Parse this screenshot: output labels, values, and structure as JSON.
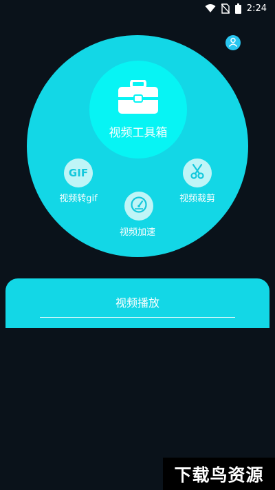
{
  "status_bar": {
    "time": "2:24",
    "icons": [
      "wifi-icon",
      "no-sim-icon",
      "battery-icon"
    ]
  },
  "header": {
    "avatar_icon": "user-icon"
  },
  "toolbox": {
    "label": "视频工具箱",
    "icon": "toolbox-icon"
  },
  "features": [
    {
      "label": "视频转gif",
      "icon": "gif-icon",
      "icon_text": "GIF"
    },
    {
      "label": "视频裁剪",
      "icon": "scissors-icon"
    },
    {
      "label": "视频加速",
      "icon": "speedometer-icon"
    }
  ],
  "player": {
    "label": "视频播放"
  },
  "watermark": {
    "text": "下载鸟资源"
  },
  "colors": {
    "background": "#0a121a",
    "circle": "#13d7e6",
    "toolbox_circle": "#07f4f4",
    "icon_bg": "#bff5f7",
    "accent": "#29c6f0"
  }
}
